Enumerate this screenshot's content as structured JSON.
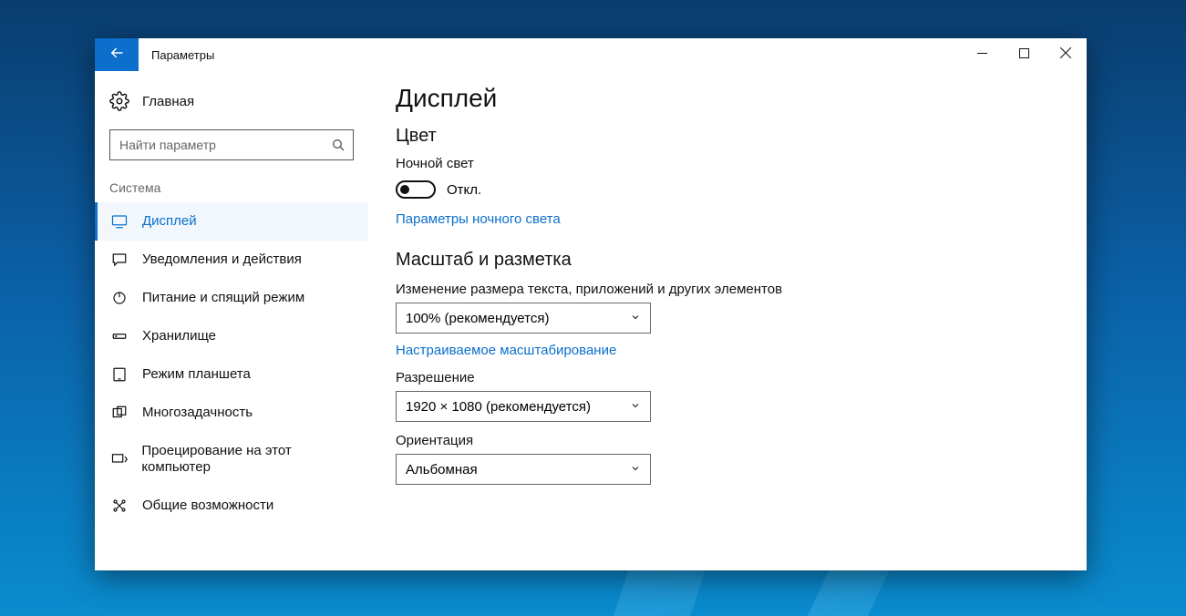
{
  "window": {
    "title": "Параметры"
  },
  "sidebar": {
    "home_label": "Главная",
    "search_placeholder": "Найти параметр",
    "category": "Система",
    "items": [
      {
        "label": "Дисплей",
        "active": true
      },
      {
        "label": "Уведомления и действия",
        "active": false
      },
      {
        "label": "Питание и спящий режим",
        "active": false
      },
      {
        "label": "Хранилище",
        "active": false
      },
      {
        "label": "Режим планшета",
        "active": false
      },
      {
        "label": "Многозадачность",
        "active": false
      },
      {
        "label": "Проецирование на этот компьютер",
        "active": false
      },
      {
        "label": "Общие возможности",
        "active": false
      }
    ]
  },
  "content": {
    "page_title": "Дисплей",
    "section_color": "Цвет",
    "night_light_label": "Ночной свет",
    "night_light_state": "Откл.",
    "night_light_settings_link": "Параметры ночного света",
    "section_scale": "Масштаб и разметка",
    "scale_label": "Изменение размера текста, приложений и других элементов",
    "scale_value": "100% (рекомендуется)",
    "custom_scale_link": "Настраиваемое масштабирование",
    "resolution_label": "Разрешение",
    "resolution_value": "1920 × 1080 (рекомендуется)",
    "orientation_label": "Ориентация",
    "orientation_value": "Альбомная"
  }
}
